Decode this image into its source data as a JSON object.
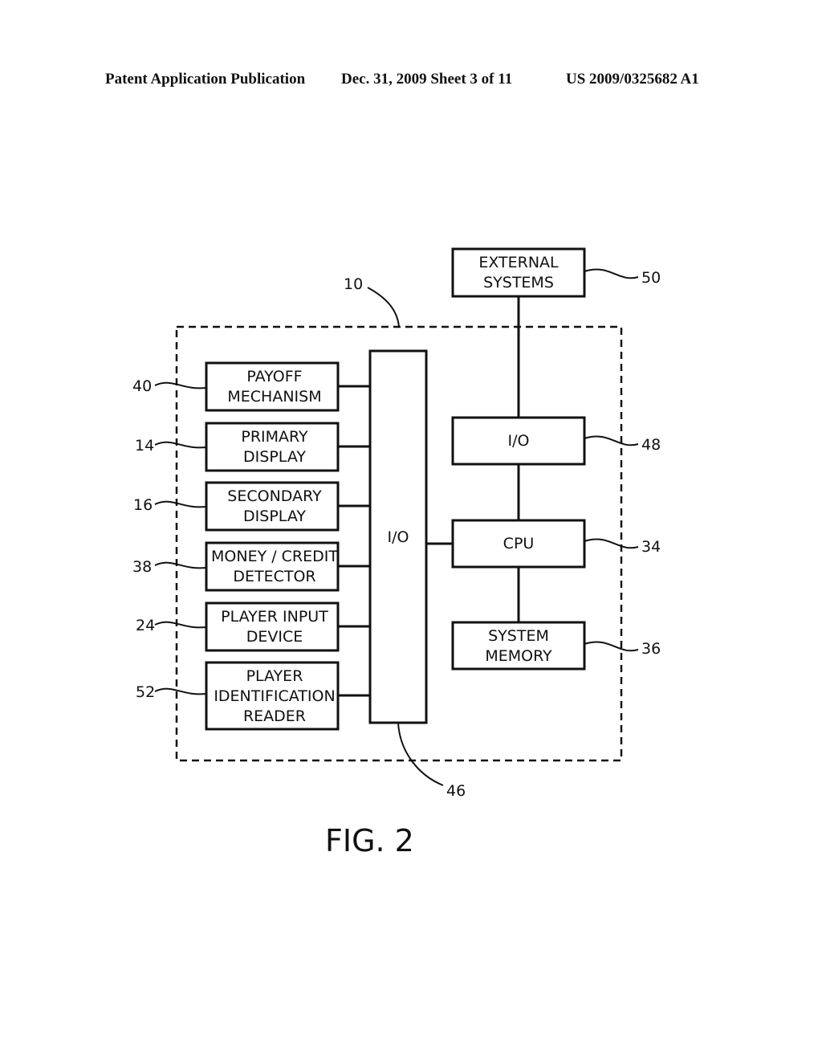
{
  "header": {
    "left": "Patent Application Publication",
    "middle": "Dec. 31, 2009   Sheet 3 of 11",
    "right": "US 2009/0325682 A1"
  },
  "diagram": {
    "system_ref": "10",
    "left_blocks": [
      {
        "ref": "40",
        "lines": [
          "PAYOFF",
          "MECHANISM"
        ]
      },
      {
        "ref": "14",
        "lines": [
          "PRIMARY",
          "DISPLAY"
        ]
      },
      {
        "ref": "16",
        "lines": [
          "SECONDARY",
          "DISPLAY"
        ]
      },
      {
        "ref": "38",
        "lines": [
          "MONEY / CREDIT",
          "DETECTOR"
        ]
      },
      {
        "ref": "24",
        "lines": [
          "PLAYER  INPUT",
          "DEVICE"
        ]
      },
      {
        "ref": "52",
        "lines": [
          "PLAYER",
          "IDENTIFICATION",
          "READER"
        ]
      }
    ],
    "io_bus": {
      "label": "I/O",
      "ref": "46"
    },
    "right_blocks": {
      "external": {
        "ref": "50",
        "lines": [
          "EXTERNAL",
          "SYSTEMS"
        ]
      },
      "io": {
        "ref": "48",
        "lines": [
          "I/O"
        ]
      },
      "cpu": {
        "ref": "34",
        "lines": [
          "CPU"
        ]
      },
      "memory": {
        "ref": "36",
        "lines": [
          "SYSTEM",
          "MEMORY"
        ]
      }
    },
    "figure_label": "FIG. 2"
  }
}
